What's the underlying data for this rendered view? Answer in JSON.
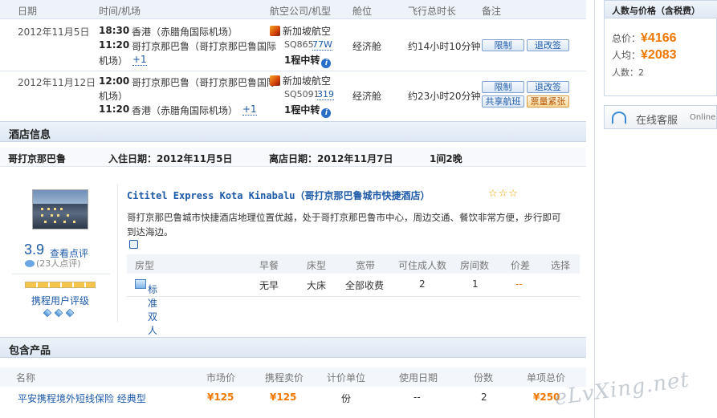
{
  "flight_header": {
    "date": "日期",
    "time_airport": "时间/机场",
    "airline_model": "航空公司/机型",
    "cabin": "舱位",
    "total_time": "飞行总时长",
    "remark": "备注"
  },
  "flights": [
    {
      "date": "2012年11月5日",
      "dep_time": "18:30",
      "dep_airport": "香港（赤腊角国际机场）",
      "arr_time": "11:20",
      "arr_airport_1": "哥打京那巴鲁（哥打京那巴鲁国际",
      "arr_airport_2": "机场）",
      "plus_day": "+1",
      "airline": "新加坡航空",
      "flight_no": "SQ865",
      "model": "77W",
      "transfer": "1程中转",
      "cabin": "经济舱",
      "duration": "约14小时10分钟",
      "btn_limit": "限制",
      "btn_refund": "退改签"
    },
    {
      "date": "2012年11月12日",
      "dep_time": "12:00",
      "dep_airport_1": "哥打京那巴鲁（哥打京那巴鲁国际",
      "dep_airport_2": "机场）",
      "arr_time": "11:20",
      "arr_airport": "香港（赤腊角国际机场）",
      "plus_day": "+1",
      "airline": "新加坡航空",
      "flight_no": "SQ5091",
      "model": "319",
      "transfer": "1程中转",
      "cabin": "经济舱",
      "duration": "约23小时20分钟",
      "btn_limit": "限制",
      "btn_refund": "退改签",
      "btn_share": "共享航班",
      "btn_tight": "票量紧张"
    }
  ],
  "hotel_section": {
    "title": "酒店信息",
    "city": "哥打京那巴鲁",
    "checkin": "入住日期：2012年11月5日",
    "checkout": "离店日期：2012年11月7日",
    "rooms_nights": "1间2晚",
    "hotel_name": "Cititel Express Kota Kinabalu（哥打京那巴鲁城市快捷酒店）",
    "stars": "☆☆☆",
    "desc_1": "哥打京那巴鲁城市快捷酒店地理位置优越，处于哥打京那巴鲁市中心，周边交通、餐饮非常方便，步行即可",
    "desc_2": "到达海边。",
    "score": "3.9",
    "view_reviews": "查看点评",
    "review_count": "(23人点评)",
    "user_rating": "携程用户评级",
    "room_header": [
      "房型",
      "早餐",
      "床型",
      "宽带",
      "可住成人数",
      "房间数",
      "价差",
      "选择"
    ],
    "room": {
      "type": "标准双人房",
      "breakfast": "无早",
      "bed": "大床",
      "broadband": "全部收费",
      "adults": "2",
      "rooms": "1",
      "price_diff": "--"
    }
  },
  "products_section": {
    "title": "包含产品",
    "header": [
      "名称",
      "市场价",
      "携程卖价",
      "计价单位",
      "使用日期",
      "份数",
      "单项总价"
    ],
    "row": {
      "name": "平安携程境外短线保险 经典型",
      "market_price": "¥125",
      "ctrip_price": "¥125",
      "unit": "份",
      "use_date": "--",
      "count": "2",
      "total": "¥250"
    }
  },
  "sidebar": {
    "title": "人数与价格（含税费）",
    "total_label": "总价：",
    "total_value": "¥4166",
    "per_label": "人均：",
    "per_value": "¥2083",
    "people_label": "人数：",
    "people_value": "2",
    "service_label": "在线客服",
    "service_online": "Online"
  },
  "watermark": "eLvXing.net"
}
